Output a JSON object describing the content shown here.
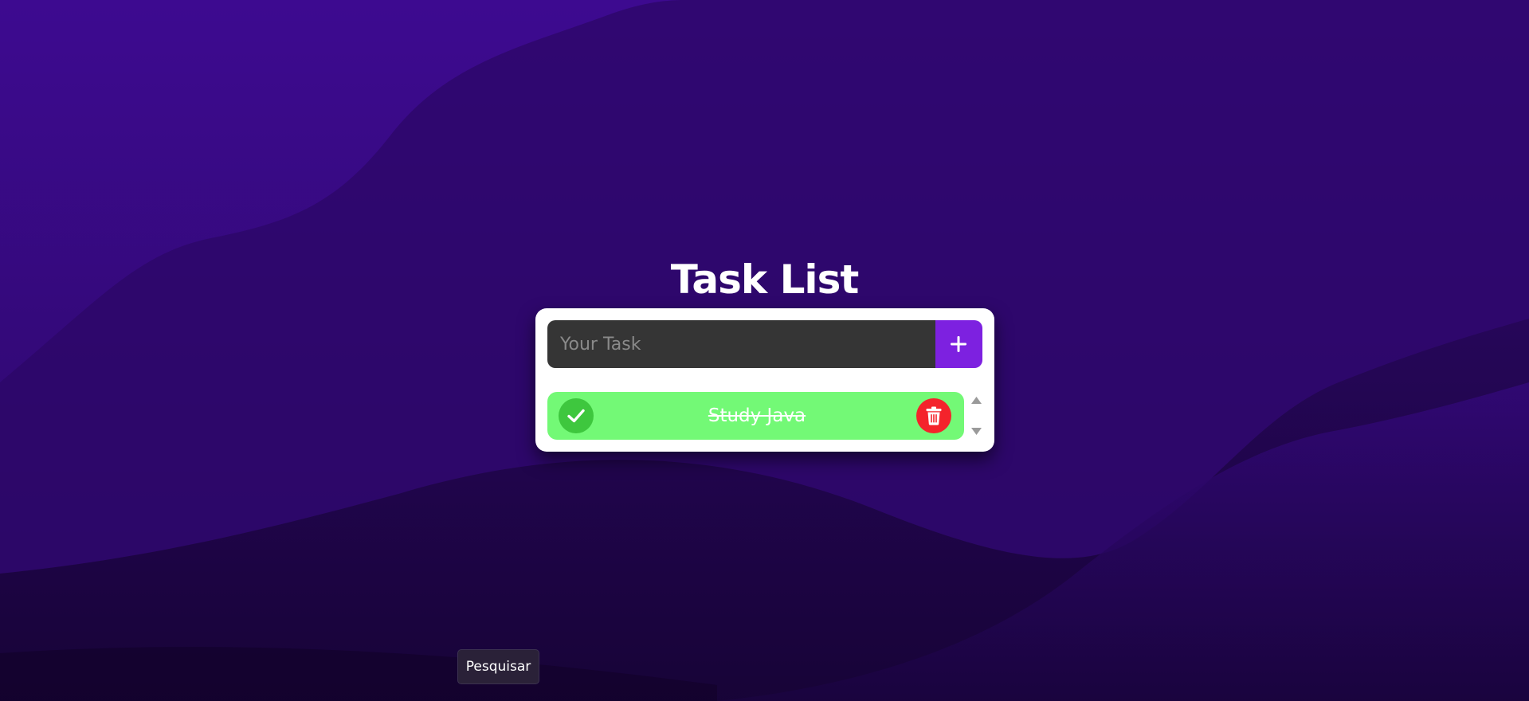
{
  "app": {
    "title": "Task List"
  },
  "input": {
    "placeholder": "Your Task",
    "value": "",
    "add_icon": "plus-icon"
  },
  "tasks": [
    {
      "text": "Study Java",
      "completed": true,
      "complete_icon": "check-icon",
      "delete_icon": "trash-icon"
    }
  ],
  "tooltip": {
    "text": "Pesquisar"
  },
  "colors": {
    "background": "#22074f",
    "accent": "#7d21e0",
    "task_done": "#73f976",
    "check": "#3ec73e",
    "delete": "#f4232b",
    "input_bg": "#353535"
  }
}
